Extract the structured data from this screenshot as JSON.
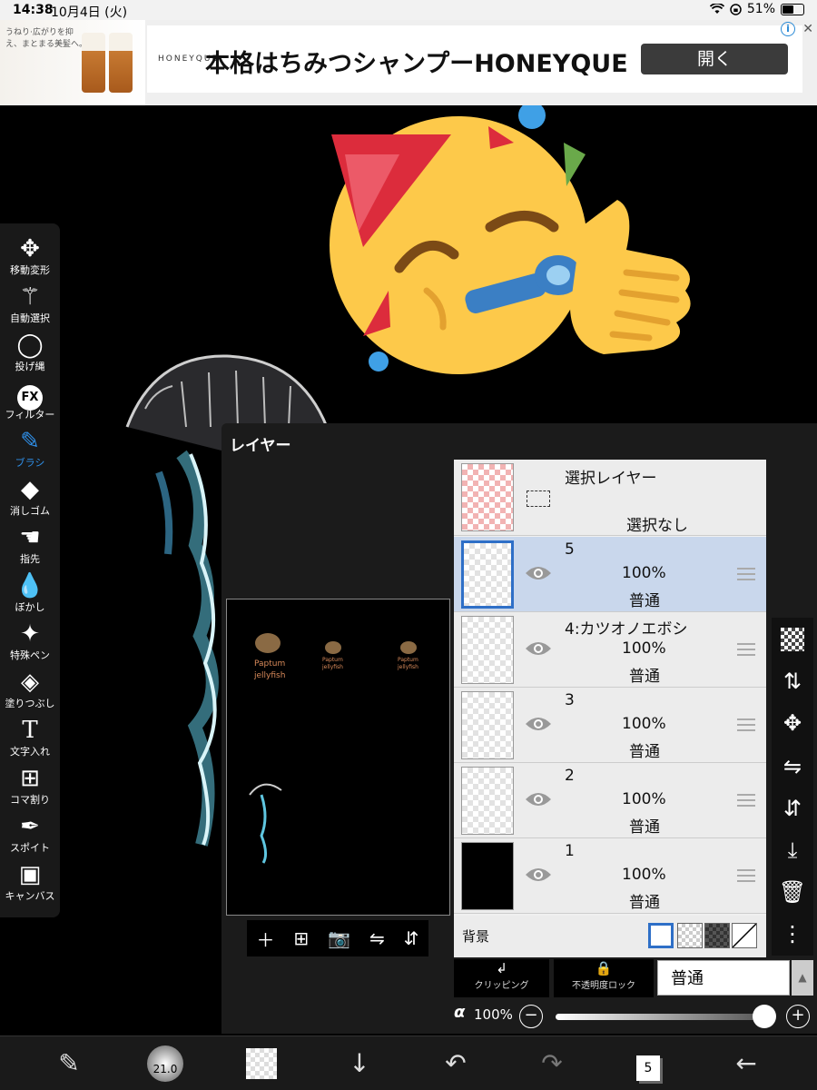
{
  "status": {
    "time": "14:38",
    "date": "10月4日 (火)",
    "battery": "51%"
  },
  "ad": {
    "thumb_text": "うねり·広がりを抑え、まとまる美髪へ。",
    "brand": "HONEYQUE",
    "headline": "本格はちみつシャンプーHONEYQUE",
    "open_label": "開く"
  },
  "tools": [
    {
      "label": "移動変形",
      "icon": "move-icon"
    },
    {
      "label": "自動選択",
      "icon": "magic-wand-icon"
    },
    {
      "label": "投げ縄",
      "icon": "lasso-icon"
    },
    {
      "label": "フィルター",
      "icon": "fx-icon"
    },
    {
      "label": "ブラシ",
      "icon": "brush-icon",
      "active": true
    },
    {
      "label": "消しゴム",
      "icon": "eraser-icon"
    },
    {
      "label": "指先",
      "icon": "finger-icon"
    },
    {
      "label": "ぼかし",
      "icon": "blur-icon"
    },
    {
      "label": "特殊ペン",
      "icon": "special-pen-icon"
    },
    {
      "label": "塗りつぶし",
      "icon": "fill-icon"
    },
    {
      "label": "文字入れ",
      "icon": "text-icon"
    },
    {
      "label": "コマ割り",
      "icon": "frame-divide-icon"
    },
    {
      "label": "スポイト",
      "icon": "eyedropper-icon"
    },
    {
      "label": "キャンバス",
      "icon": "canvas-icon"
    }
  ],
  "layer_panel": {
    "title": "レイヤー",
    "selection_layer": {
      "name": "選択レイヤー",
      "status": "選択なし"
    },
    "layers": [
      {
        "name": "5",
        "opacity": "100%",
        "mode": "普通",
        "selected": true
      },
      {
        "name": "4:カツオノエボシ",
        "opacity": "100%",
        "mode": "普通"
      },
      {
        "name": "3",
        "opacity": "100%",
        "mode": "普通"
      },
      {
        "name": "2",
        "opacity": "100%",
        "mode": "普通"
      },
      {
        "name": "1",
        "opacity": "100%",
        "mode": "普通"
      }
    ],
    "background_label": "背景",
    "clipping_label": "クリッピング",
    "alpha_lock_label": "不透明度ロック",
    "blend_mode": "普通",
    "alpha_symbol": "α",
    "alpha_value": "100%",
    "alpha_fraction": 1.0
  },
  "preview": {
    "jelly_texts": [
      "Paptum",
      "jellyfish"
    ]
  },
  "bottom": {
    "brush_size": "21.0",
    "layer_count": "5"
  },
  "colors": {
    "accent": "#2f8fe8",
    "selected_layer": "#c9d7ec",
    "panel_bg": "#1b1b1b"
  }
}
